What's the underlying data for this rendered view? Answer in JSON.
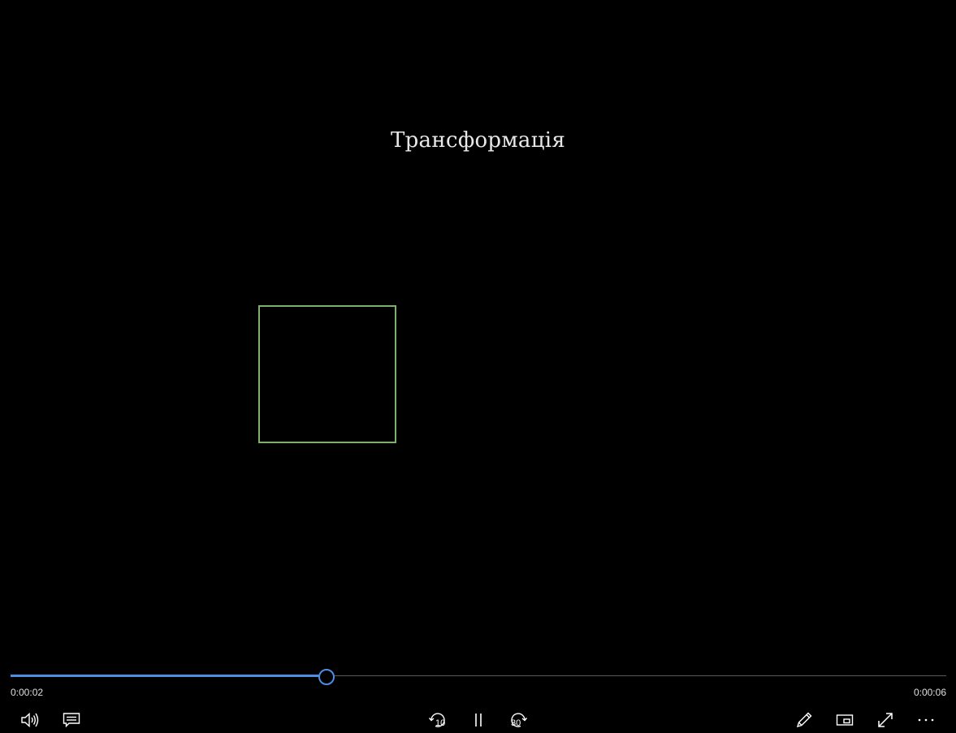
{
  "video": {
    "title": "Трансформація",
    "shape_color": "#7fb069"
  },
  "playback": {
    "current_time": "0:00:02",
    "total_time": "0:00:06",
    "progress": 0.3368,
    "accent_color": "#4a8fe0"
  },
  "controls": {
    "left": [
      {
        "name": "volume-button",
        "icon": "speaker-icon"
      },
      {
        "name": "captions-button",
        "icon": "captions-icon"
      }
    ],
    "center": [
      {
        "name": "skip-back-10-button",
        "icon": "rewind-10-icon",
        "label": "10"
      },
      {
        "name": "pause-button",
        "icon": "pause-icon"
      },
      {
        "name": "skip-forward-30-button",
        "icon": "forward-30-icon",
        "label": "30"
      }
    ],
    "right": [
      {
        "name": "edit-button",
        "icon": "pencil-icon"
      },
      {
        "name": "mini-view-button",
        "icon": "mini-view-icon"
      },
      {
        "name": "fullscreen-button",
        "icon": "expand-icon"
      },
      {
        "name": "more-button",
        "icon": "more-icon"
      }
    ]
  }
}
